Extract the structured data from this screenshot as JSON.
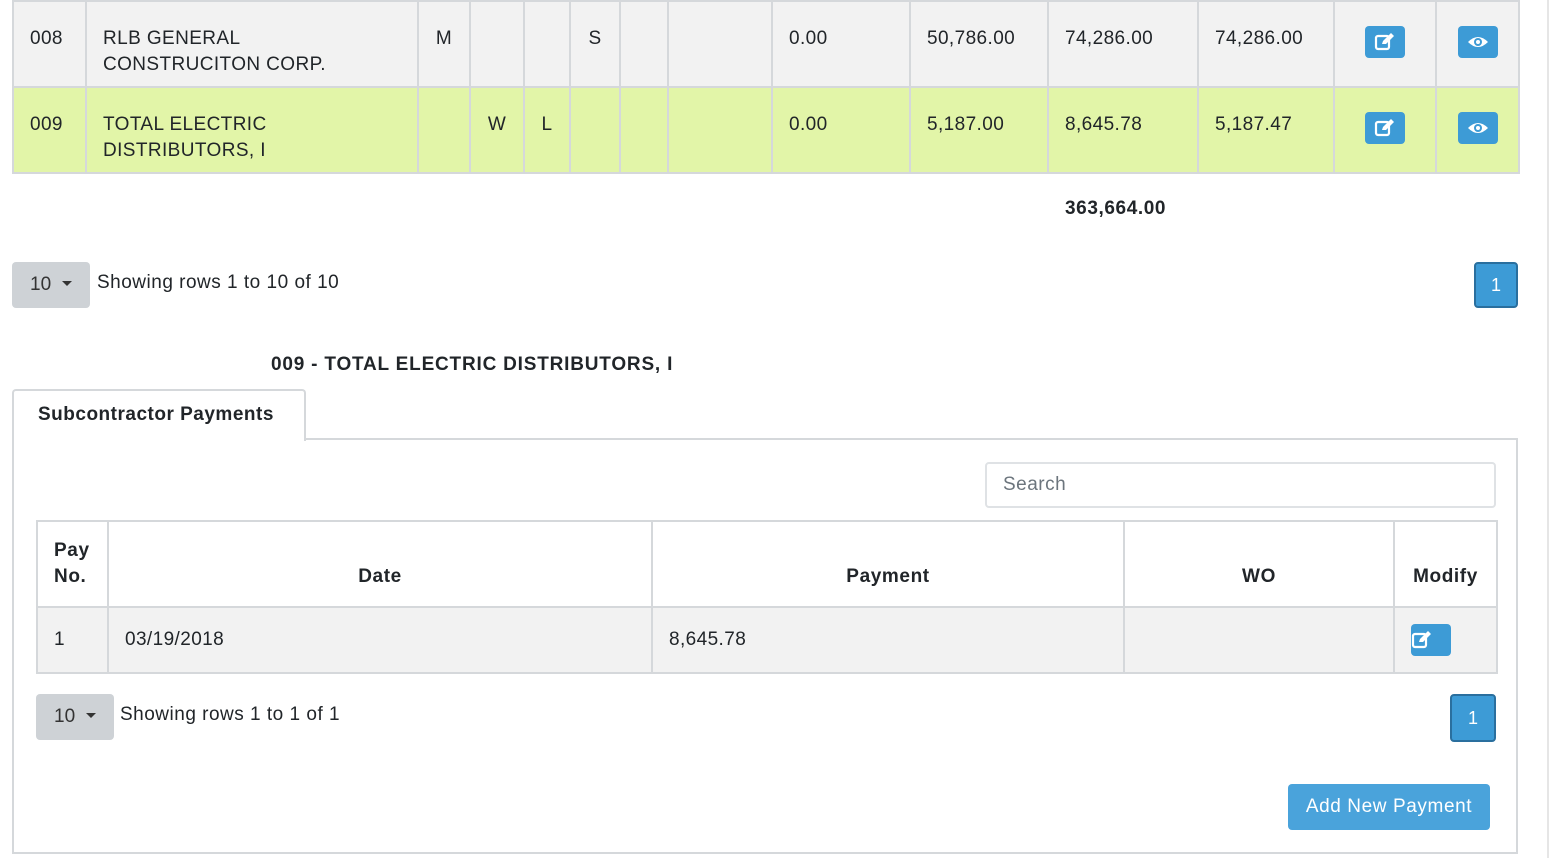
{
  "top_table": {
    "rows": [
      {
        "id": "008",
        "name": "RLB GENERAL CONSTRUCITON CORP.",
        "c1": "M",
        "c2": "",
        "c3": "",
        "c4": "S",
        "c5": "",
        "c6": "",
        "v1": "0.00",
        "v2": "50,786.00",
        "v3": "74,286.00",
        "v4": "74,286.00"
      },
      {
        "id": "009",
        "name": "TOTAL ELECTRIC DISTRIBUTORS, I",
        "c1": "",
        "c2": "W",
        "c3": "L",
        "c4": "",
        "c5": "",
        "c6": "",
        "v1": "0.00",
        "v2": "5,187.00",
        "v3": "8,645.78",
        "v4": "5,187.47"
      }
    ],
    "grand_total": "363,664.00"
  },
  "top_pagination": {
    "page_size": "10",
    "showing": "Showing rows 1 to 10 of 10",
    "current_page": "1"
  },
  "section_title": "009 - TOTAL ELECTRIC DISTRIBUTORS, I",
  "tabs": [
    {
      "label": "Subcontractor Payments"
    }
  ],
  "search": {
    "placeholder": "Search",
    "value": ""
  },
  "payments_table": {
    "headers": {
      "pay_no": "Pay No.",
      "date": "Date",
      "payment": "Payment",
      "wo": "WO",
      "modify": "Modify"
    },
    "rows": [
      {
        "pay_no": "1",
        "date": "03/19/2018",
        "payment": "8,645.78",
        "wo": ""
      }
    ]
  },
  "payments_pagination": {
    "page_size": "10",
    "showing": "Showing rows 1 to 1 of 1",
    "current_page": "1"
  },
  "add_button_label": "Add New Payment",
  "icons": {
    "edit": "edit-icon",
    "view": "eye-icon"
  },
  "colors": {
    "accent": "#3d9bd6",
    "highlight_row": "#e2f5a8",
    "row_bg": "#f2f2f2"
  }
}
